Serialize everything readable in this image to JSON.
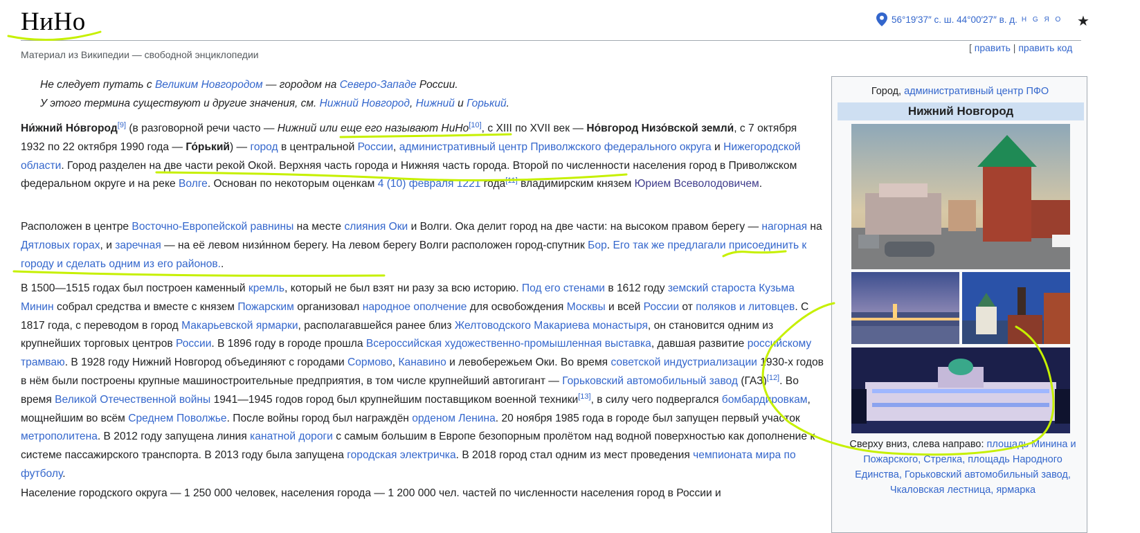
{
  "page": {
    "title": "НиНо",
    "subtitle": "Материал из Википедии — свободной энциклопедии",
    "coordinates": "56°19′37″ с. ш. 44°00′27″ в. д.",
    "coord_links": "H G Я O",
    "edit_links": {
      "open": "[ ",
      "edit": "править",
      "sep": " | ",
      "edit_code": "править код"
    }
  },
  "hatnotes": [
    [
      "Не следует путать с ",
      "Великим Новгородом",
      " — городом на ",
      "Северо-Западе",
      " России."
    ],
    [
      "У этого термина существуют и другие значения, см. ",
      "Нижний Новгород",
      ", ",
      "Нижний",
      " и ",
      "Горький",
      "."
    ]
  ],
  "para1": {
    "t1": "Ни́жний Но́вгород",
    "r1": "[9]",
    "t2": " (в разговорной речи часто — ",
    "t3": "Нижний или еще его называют НиНо",
    "r2": "[10]",
    "t4": ", с XIII по XVII век — ",
    "t5": "Но́вгород Низо́вской земли́",
    "t6": ", с 7 октября 1932 по 22 октября 1990 года — ",
    "t7": "Го́рький",
    "t8": ") — ",
    "l1": "город",
    "t9": " в центральной ",
    "l2": "России",
    "t10": ", ",
    "l3": "административный центр Приволжского федерального округа",
    "t11": " и ",
    "l4": "Нижегородской области",
    "t12": ". Город разделен на две части рекой Окой. Верхняя часть города и Нижняя часть города. Второй по численности населения город в Приволжском федеральном округе и на реке ",
    "l5": "Волге",
    "t13": ". Основан по некоторым оценкам ",
    "l6": "4 (10) февраля 1221",
    "t14": " года",
    "r3": "[11]",
    "t15": " владимирским князем ",
    "l7": "Юрием Всеволодовичем",
    "t16": "."
  },
  "para2": {
    "t1": "Расположен в центре ",
    "l1": "Восточно-Европейской равнины",
    "t2": " на месте ",
    "l2": "слияния Оки",
    "t3": " и Волги. Ока делит город на две части: на высоком правом берегу — ",
    "l3": "нагорная",
    "t4": " на ",
    "l4": "Дятловых горах",
    "t5": ", и ",
    "l5": "заречная",
    "t6": " — на её левом низи́нном берегу. На левом берегу Волги расположен город-спутник ",
    "l6": "Бор",
    "t7": ". ",
    "l7": "Его так же предлагали присоединить к городу и сделать одним из его районов.",
    "t8": "."
  },
  "para3": {
    "t1": "В 1500—1515 годах был построен каменный ",
    "l1": "кремль",
    "t2": ", который не был взят ни разу за всю историю. ",
    "l2": "Под его стенами",
    "t3": " в 1612 году ",
    "l3": "земский староста Кузьма Минин",
    "t4": " собрал средства и вместе с князем ",
    "l4": "Пожарским",
    "t5": " организовал ",
    "l5": "народное ополчение",
    "t6": " для освобождения ",
    "l6": "Москвы",
    "t7": " и всей ",
    "l7": "России",
    "t8": " от ",
    "l8": "поляков и литовцев",
    "t9": ". С 1817 года, с переводом в город ",
    "l9": "Макарьевской ярмарки",
    "t10": ", располагавшейся ранее близ ",
    "l10": "Желтоводского Макариева монастыря",
    "t11": ", он становится одним из крупнейших торговых центров ",
    "l11": "России",
    "t12": ". В 1896 году в городе прошла ",
    "l12": "Всероссийская художественно-промышленная выставка",
    "t13": ", давшая развитие ",
    "l13": "российскому трамваю",
    "t14": ". В 1928 году Нижний Новгород объединяют с городами ",
    "l14": "Сормово",
    "t15": ", ",
    "l15": "Канавино",
    "t16": " и левобережьем Оки. Во время ",
    "l16": "советской индустриализации",
    "t17": " 1930-х годов в нём были построены крупные машиностроительные предприятия, в том числе крупнейший автогигант — ",
    "l17": "Горьковский автомобильный завод",
    "t18": " (ГАЗ)",
    "r1": "[12]",
    "t19": ". Во время ",
    "l18": "Великой Отечественной войны",
    "t20": " 1941—1945 годов город был крупнейшим поставщиком военной техники",
    "r2": "[13]",
    "t21": ", в силу чего подвергался ",
    "l19": "бомбардировкам",
    "t22": ", мощнейшим во всём ",
    "l20": "Среднем Поволжье",
    "t23": ". После войны город был награждён ",
    "l21": "орденом Ленина",
    "t24": ". 20 ноября 1985 года в городе был запущен первый участок ",
    "l22": "метрополитена",
    "t25": ". В 2012 году запущена линия ",
    "l23": "канатной дороги",
    "t26": " с самым большим в Европе безопорным пролётом над водной поверхностью как дополнение к системе пассажирского транспорта. В 2013 году была запущена ",
    "l24": "городская электричка",
    "t27": ". В 2018 город стал одним из мест проведения ",
    "l25": "чемпионата мира по футболу",
    "t28": "."
  },
  "para4_partial": "Население городского округа — 1 250 000 человек, населения города — 1 200 000 чел. частей по численности населения город в России и",
  "infobox": {
    "type_prefix": "Город, ",
    "type_link": "административный центр ПФО",
    "name": "Нижний Новгород",
    "caption_prefix": "Сверху вниз, слева направо: ",
    "caption_links": "площадь Минина и Пожарского, Стрелка, площадь Народного Единства, Горьковский автомобильный завод, Чкаловская лестница, ярмарка"
  },
  "colors": {
    "link": "#3366cc",
    "visited": "#3d3a8a",
    "annotation": "#c6f000",
    "infobox_header": "#cedff2"
  },
  "icons": [
    "map-pin-icon",
    "star-icon"
  ]
}
